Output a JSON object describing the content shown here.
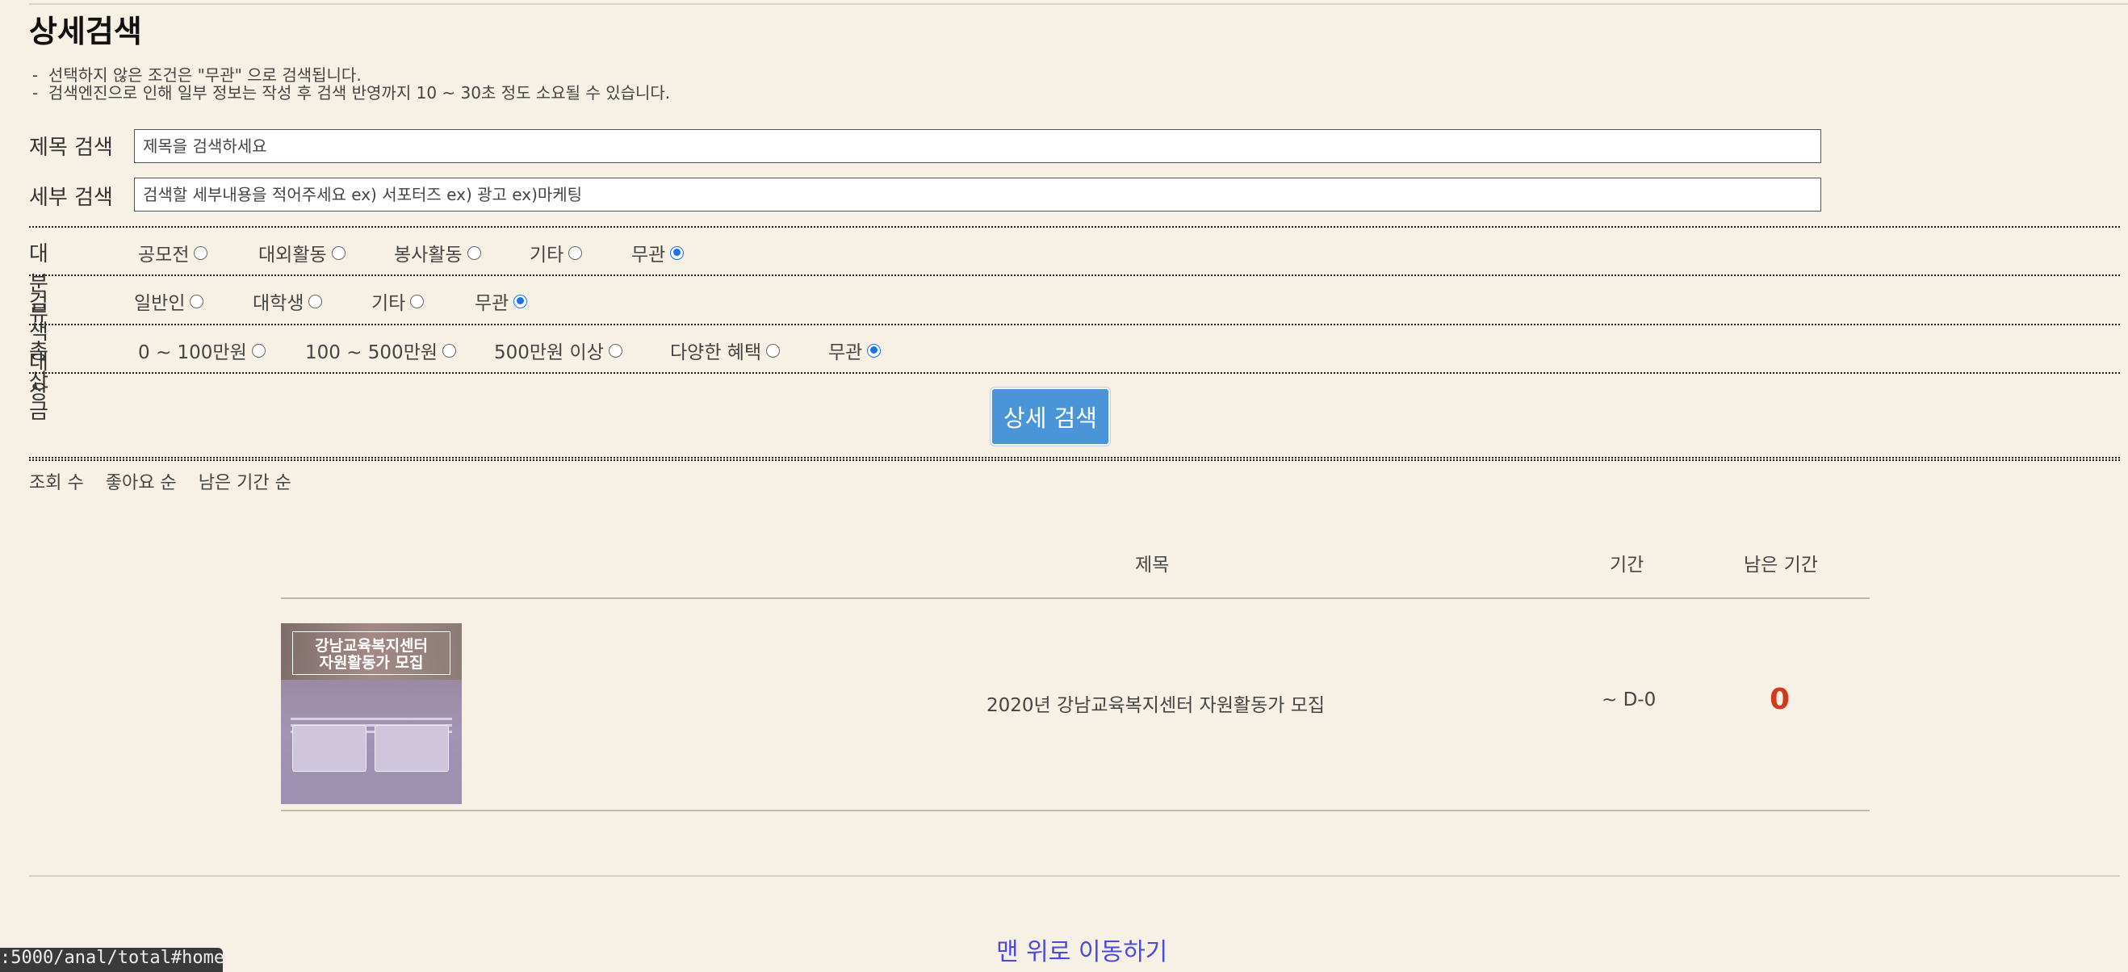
{
  "page": {
    "title": "상세검색",
    "notes": [
      "-  선택하지 않은 조건은 \"무관\" 으로 검색됩니다.",
      "-  검색엔진으로 인해 일부 정보는 작성 후 검색 반영까지 10 ~ 30초 정도 소요될 수 있습니다."
    ]
  },
  "search": {
    "title_label": "제목 검색",
    "title_placeholder": "제목을 검색하세요",
    "detail_label": "세부 검색",
    "detail_placeholder": "검색할 세부내용을 적어주세요 ex) 서포터즈 ex) 광고 ex)마케팅"
  },
  "category": {
    "label": "대 분류",
    "options": [
      "공모전",
      "대외활동",
      "봉사활동",
      "기타",
      "무관"
    ],
    "selected": "무관"
  },
  "target": {
    "label": "검색 대상",
    "options": [
      "일반인",
      "대학생",
      "기타",
      "무관"
    ],
    "selected": "무관"
  },
  "prize": {
    "label": "총 상금",
    "options": [
      "0 ~ 100만원",
      "100 ~ 500만원",
      "500만원 이상",
      "다양한 혜택",
      "무관"
    ],
    "selected": "무관"
  },
  "detail_button": "상세 검색",
  "sort": [
    "조회 수",
    "좋아요 순",
    "남은 기간 순"
  ],
  "table": {
    "headers": {
      "title": "제목",
      "period": "기간",
      "remaining": "남은 기간"
    },
    "rows": [
      {
        "thumb_line1": "강남교육복지센터",
        "thumb_line2": "자원활동가 모집",
        "title": "2020년 강남교육복지센터 자원활동가 모집",
        "period": "~ D-0",
        "remaining": "0"
      }
    ]
  },
  "footer": {
    "top_link": "맨 위로 이동하기"
  },
  "status_url": ":5000/anal/total#home",
  "colors": {
    "accent": "#4a95d8",
    "dday": "#d13a1e",
    "link": "#4a4adf",
    "background": "#f7f0e5"
  }
}
